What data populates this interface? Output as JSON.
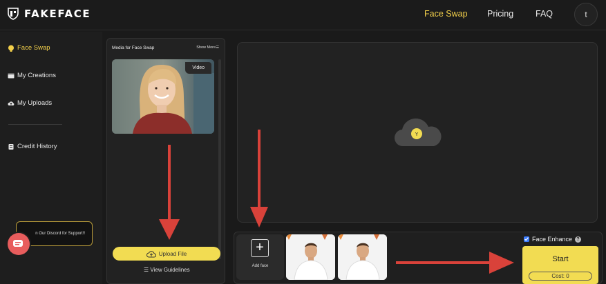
{
  "brand": {
    "name": "FAKEFACE"
  },
  "nav": {
    "items": [
      {
        "label": "Face Swap",
        "active": true
      },
      {
        "label": "Pricing",
        "active": false
      },
      {
        "label": "FAQ",
        "active": false
      }
    ],
    "avatar_initial": "t"
  },
  "sidebar": {
    "items": [
      {
        "label": "Face Swap",
        "icon": "bulb-icon",
        "active": true
      },
      {
        "label": "My Creations",
        "icon": "folder-icon",
        "active": false
      },
      {
        "label": "My Uploads",
        "icon": "cloud-upload-icon",
        "active": false
      },
      {
        "label": "Credit History",
        "icon": "receipt-icon",
        "active": false
      }
    ],
    "discord_text": "n Our Discord for Support!!"
  },
  "media": {
    "title": "Media for Face Swap",
    "show_more": "Show More",
    "badge": "Video",
    "upload_label": "Upload File",
    "guidelines_label": "View Guidelines"
  },
  "faces": {
    "add_label": "Add face"
  },
  "controls": {
    "enhance_label": "Face Enhance",
    "enhance_checked": true,
    "help_symbol": "?",
    "start_label": "Start",
    "cost_label": "Cost: 0"
  },
  "colors": {
    "accent": "#f2cf4a",
    "button": "#f2dc52",
    "arrow": "#d9423a",
    "panel": "#222222",
    "background": "#1a1a1a"
  }
}
